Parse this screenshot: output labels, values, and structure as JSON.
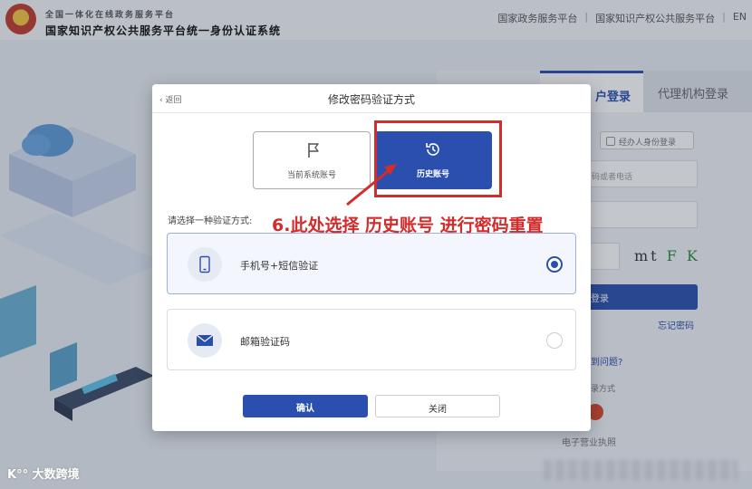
{
  "header": {
    "subtitle": "全国一体化在线政务服务平台",
    "title": "国家知识产权公共服务平台统一身份认证系统",
    "links": [
      "国家政务服务平台",
      "国家知识产权公共服务平台",
      "EN"
    ]
  },
  "login": {
    "tab_user": "户登录",
    "tab_agent": "代理机构登录",
    "agent_check": "经办人身份登录",
    "field_hint": "码或者电话",
    "captcha": [
      "m",
      "t",
      " F K"
    ],
    "login_button": "登录",
    "forgot_password": "忘记密码",
    "question": "到问题?",
    "other_way": "录方式",
    "biz_license": "电子营业执照"
  },
  "modal": {
    "back": "‹ 返回",
    "title": "修改密码验证方式",
    "current_account": "当前系统账号",
    "history_account": "历史账号",
    "choose_label": "请选择一种验证方式:",
    "methods": [
      {
        "label": "手机号+短信验证",
        "selected": true
      },
      {
        "label": "邮箱验证码",
        "selected": false
      }
    ],
    "confirm": "确认",
    "close": "关闭"
  },
  "annotation": {
    "text": "6.此处选择 历史账号 进行密码重置",
    "color": "#d42b2b"
  },
  "watermark": "大数跨境",
  "colors": {
    "primary": "#2a4fae",
    "annotation": "#d42b2b"
  }
}
